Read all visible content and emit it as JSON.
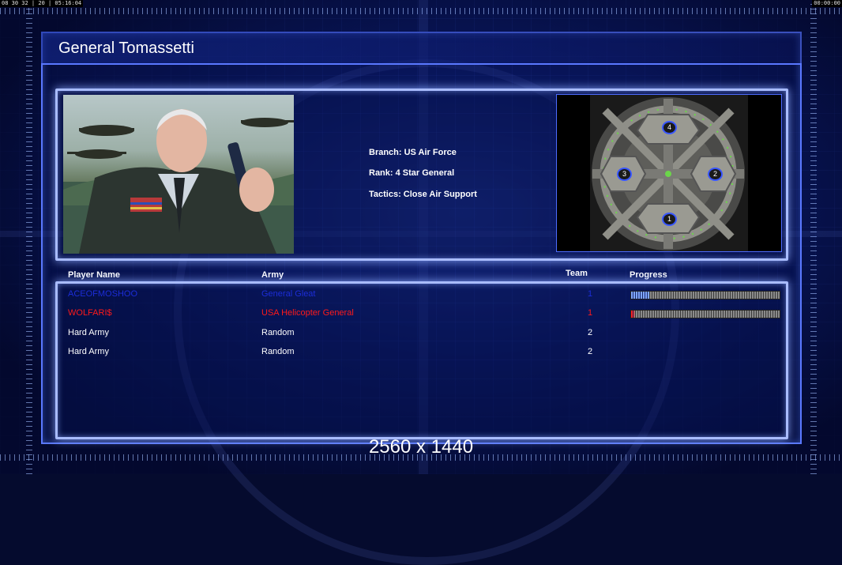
{
  "hud": {
    "left_clock": "08 30 32 | 20 | 05:16:04",
    "right_clock": "00:00:00"
  },
  "general": {
    "name": "General Tomassetti",
    "branch": "Branch: US Air Force",
    "rank": "Rank: 4 Star General",
    "tactics": "Tactics: Close Air Support"
  },
  "map": {
    "start_positions": [
      "1",
      "2",
      "3",
      "4"
    ]
  },
  "players_table": {
    "headers": {
      "name": "Player Name",
      "army": "Army",
      "team": "Team",
      "progress": "Progress"
    },
    "rows": [
      {
        "name": "ACEOFMOSHOO",
        "army": "General Gleat",
        "team": "1",
        "color": "#1c2dd8",
        "progress": 0.12,
        "progress_color": "#7ea6ff"
      },
      {
        "name": "WOLFARI$",
        "army": "USA Helicopter General",
        "team": "1",
        "color": "#ff1a1a",
        "progress": 0.02,
        "progress_color": "#ff2020"
      },
      {
        "name": "Hard Army",
        "army": "Random",
        "team": "2",
        "color": "#ffffff",
        "progress": null
      },
      {
        "name": "Hard Army",
        "army": "Random",
        "team": "2",
        "color": "#ffffff",
        "progress": null
      }
    ]
  },
  "resolution_label": "2560 x 1440"
}
